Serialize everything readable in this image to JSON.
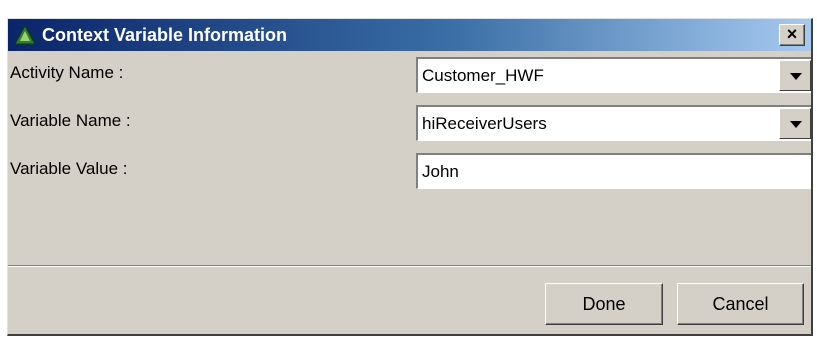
{
  "window": {
    "title": "Context Variable Information",
    "close_label": "×"
  },
  "fields": [
    {
      "label": "Activity Name :",
      "value": "Customer_HWF",
      "control": "dropdown"
    },
    {
      "label": "Variable Name :",
      "value": "hiReceiverUsers",
      "control": "dropdown"
    },
    {
      "label": "Variable Value :",
      "value": "John",
      "control": "text"
    }
  ],
  "buttons": {
    "done": "Done",
    "cancel": "Cancel"
  },
  "colors": {
    "titlebar_start": "#0a246a",
    "titlebar_end": "#a6caf0",
    "dialog_bg": "#d4d0c8",
    "icon": "#2e7d32"
  },
  "icons": {
    "title": "app-triangle-icon",
    "close": "close-icon",
    "dropdown": "chevron-down-icon"
  }
}
